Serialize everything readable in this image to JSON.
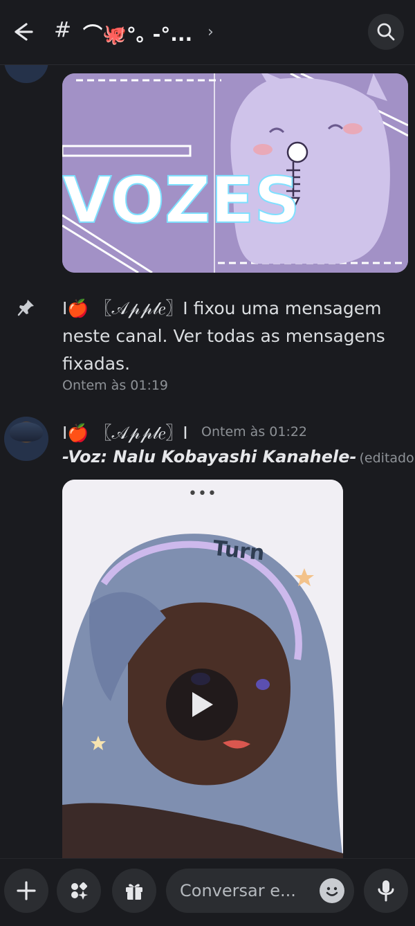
{
  "header": {
    "hash": "#",
    "channel_name": "⌒🐙°｡ -°...",
    "chevron": "›"
  },
  "banner": {
    "title": "VOZES"
  },
  "system_message": {
    "text": "Ⅰ🍎 〖𝒜𝓅𝓅𝓁𝑒〗Ⅰ fixou uma mensagem neste canal. Ver todas as mensagens fixadas.",
    "timestamp": "Ontem às 01:19"
  },
  "message": {
    "author": "Ⅰ🍎 〖𝒜𝓅𝓅𝓁𝑒〗Ⅰ",
    "timestamp": "Ontem às 01:22",
    "content": "-Voz: Nalu Kobayashi Kanahele-",
    "edited": "(editado)"
  },
  "video": {
    "more": "•••",
    "overlay_text": "Turn"
  },
  "composer": {
    "placeholder": "Conversar e..."
  },
  "colors": {
    "background": "#1a1b1f",
    "surface": "#2b2d31",
    "banner_purple": "#a796c9"
  }
}
